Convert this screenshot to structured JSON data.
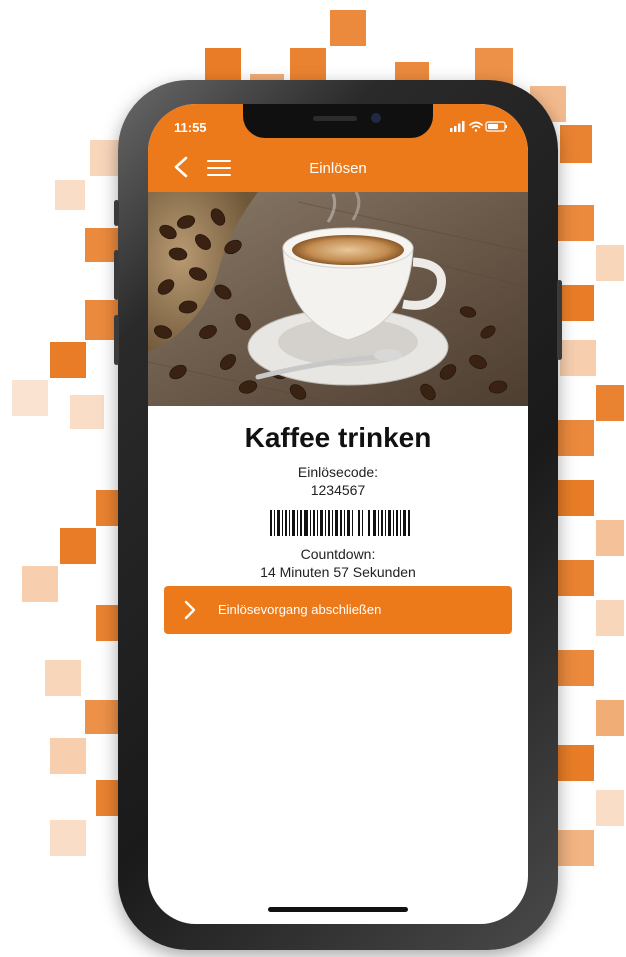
{
  "status_bar": {
    "time": "11:55"
  },
  "nav": {
    "title": "Einlösen",
    "back_icon": "chevron-left-icon",
    "menu_icon": "hamburger-menu-icon"
  },
  "hero": {
    "image": "coffee-cup-and-beans-photo"
  },
  "offer": {
    "title": "Kaffee trinken",
    "code_label": "Einlösecode:",
    "code_value": "1234567",
    "countdown_label": "Countdown:",
    "countdown_value": "14 Minuten 57 Sekunden"
  },
  "action": {
    "label": "Einlösevorgang abschließen",
    "icon": "chevron-right-icon"
  },
  "colors": {
    "accent": "#ec7a1a",
    "text": "#1a1a1a",
    "background": "#ffffff"
  }
}
